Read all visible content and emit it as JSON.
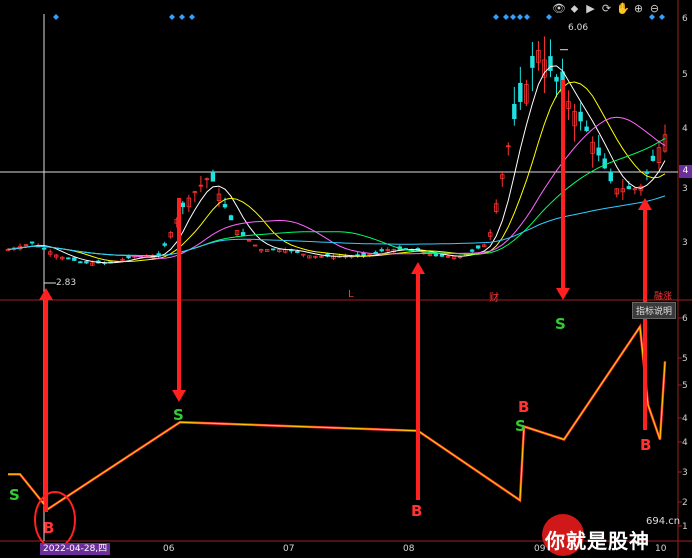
{
  "toolbar": {
    "icons": [
      "eye-icon",
      "double-diamond-icon",
      "play-icon",
      "refresh-icon",
      "hand-icon",
      "zoom-in-icon",
      "zoom-out-icon"
    ],
    "glyphs": [
      "👁",
      "⬥",
      "▶",
      "⟳",
      "✋",
      "⊕",
      "⊖"
    ]
  },
  "price_axis": {
    "labels": [
      "6",
      "5",
      "4",
      "4",
      "3",
      "3"
    ]
  },
  "indicator_axis": {
    "labels": [
      "6",
      "5",
      "5",
      "4",
      "4",
      "3",
      "2",
      "1",
      "1"
    ]
  },
  "price_annotations": {
    "high": "6.06",
    "low": "2.83",
    "current_box": "4"
  },
  "event_markers": [
    {
      "text": "L",
      "color": "#ff3333"
    },
    {
      "text": "财",
      "color": "#ff3333"
    },
    {
      "text": "融涨",
      "color": "#ff3333"
    }
  ],
  "indicator_button": "指标说明",
  "dates": {
    "current": "2022-04-28,四",
    "months": [
      "06",
      "07",
      "08",
      "09",
      "10"
    ]
  },
  "signals": [
    "S",
    "B",
    "S",
    "B",
    "B",
    "S",
    "S",
    "B"
  ],
  "watermark": {
    "text": "你就是股神",
    "url": "694.cn"
  },
  "colors": {
    "up": "#ff3333",
    "down": "#20e0e0",
    "ma5": "#ffffff",
    "ma10": "#ffff00",
    "ma20": "#ff66ff",
    "ma30": "#00ff66",
    "ma60": "#33ccff",
    "zigzag_outer": "#ff3333",
    "zigzag_inner": "#ffcc00",
    "signal_s": "#33cc33",
    "signal_b": "#ff3333"
  },
  "chart_data": [
    {
      "type": "line",
      "title": "",
      "series": [
        {
          "values": [
            3.1,
            3.2,
            3.0,
            2.9,
            2.9,
            3.0,
            3.0,
            3.8,
            4.2,
            3.4,
            3.1,
            3.1,
            3.0,
            3.0,
            3.0,
            3.1,
            3.1,
            3.0,
            3.0,
            3.2,
            5.0,
            6.06,
            5.4,
            4.8,
            4.0,
            4.0,
            4.8
          ]
        }
      ],
      "ylim": [
        2.5,
        6.5
      ]
    },
    {
      "type": "line",
      "title": "",
      "series": [
        {
          "values": [
            2.4,
            2.4,
            1.6,
            3.6,
            3.4,
            1.8,
            3.5,
            3.2,
            5.8,
            4.0,
            3.2,
            5.0
          ]
        }
      ]
    }
  ]
}
